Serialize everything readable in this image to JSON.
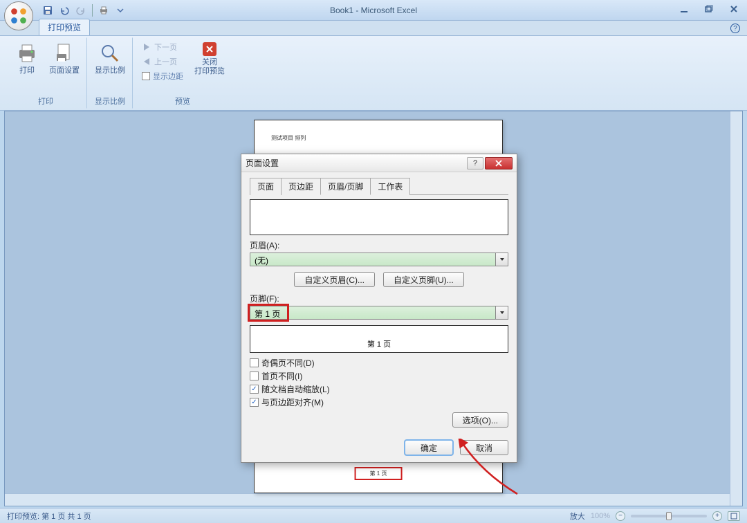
{
  "window": {
    "title": "Book1 - Microsoft Excel",
    "tab": "打印预览"
  },
  "ribbon": {
    "groups": {
      "print": {
        "label": "打印",
        "print_btn": "打印",
        "page_setup_btn": "页面设置"
      },
      "zoom": {
        "label": "显示比例",
        "zoom_btn": "显示比例"
      },
      "preview": {
        "label": "预览",
        "next_page": "下一页",
        "prev_page": "上一页",
        "show_margins": "显示边距",
        "close_line1": "关闭",
        "close_line2": "打印预览"
      }
    }
  },
  "page_preview": {
    "header_text": "测试项目 排列",
    "footer_text": "第 1 页"
  },
  "dialog": {
    "title": "页面设置",
    "tabs": {
      "page": "页面",
      "margins": "页边距",
      "headerfooter": "页眉/页脚",
      "sheet": "工作表"
    },
    "header_label": "页眉(A):",
    "header_value": "(无)",
    "custom_header_btn": "自定义页眉(C)...",
    "custom_footer_btn": "自定义页脚(U)...",
    "footer_label": "页脚(F):",
    "footer_value": "第 1 页",
    "footer_preview": "第 1 页",
    "chk_diff_odd_even": "奇偶页不同(D)",
    "chk_diff_first": "首页不同(I)",
    "chk_scale_doc": "随文档自动缩放(L)",
    "chk_align_margins": "与页边距对齐(M)",
    "options_btn": "选项(O)...",
    "ok": "确定",
    "cancel": "取消"
  },
  "statusbar": {
    "text": "打印预览: 第 1 页 共 1 页",
    "zoom_label": "放大",
    "zoom_pct": "100%"
  }
}
